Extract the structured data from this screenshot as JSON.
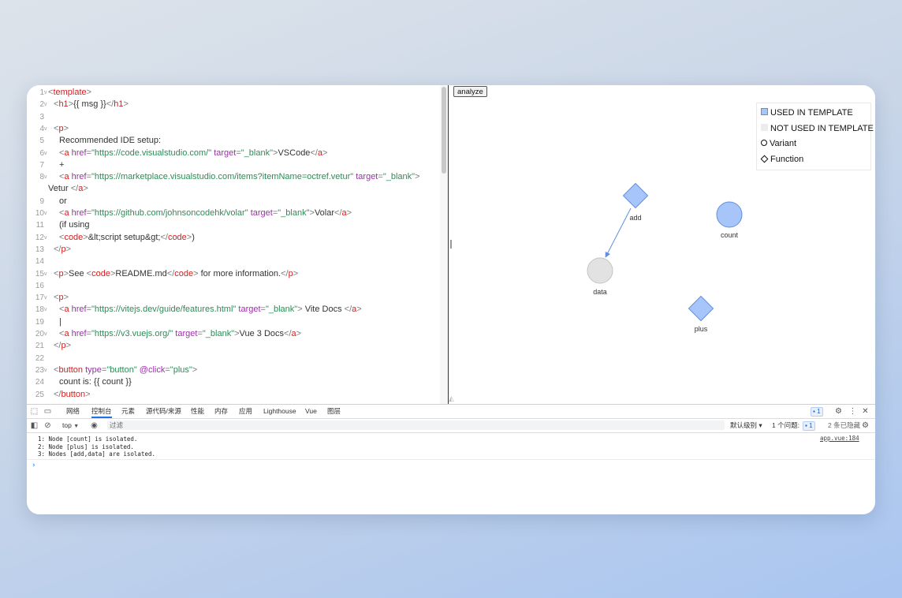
{
  "editor": {
    "lines": [
      {
        "n": "1",
        "fold": true,
        "indent": 0,
        "tokens": [
          [
            "punc",
            "<"
          ],
          [
            "tag",
            "template"
          ],
          [
            "punc",
            ">"
          ]
        ]
      },
      {
        "n": "2",
        "fold": true,
        "indent": 1,
        "tokens": [
          [
            "punc",
            "<"
          ],
          [
            "tag",
            "h1"
          ],
          [
            "punc",
            ">"
          ],
          [
            "txt",
            "{{ msg }}"
          ],
          [
            "punc",
            "</"
          ],
          [
            "tag",
            "h1"
          ],
          [
            "punc",
            ">"
          ]
        ]
      },
      {
        "n": "3",
        "fold": false,
        "indent": 0,
        "tokens": []
      },
      {
        "n": "4",
        "fold": true,
        "indent": 1,
        "tokens": [
          [
            "punc",
            "<"
          ],
          [
            "tag",
            "p"
          ],
          [
            "punc",
            ">"
          ]
        ]
      },
      {
        "n": "5",
        "fold": false,
        "indent": 2,
        "tokens": [
          [
            "txt",
            "Recommended IDE setup:"
          ]
        ]
      },
      {
        "n": "6",
        "fold": true,
        "indent": 2,
        "tokens": [
          [
            "punc",
            "<"
          ],
          [
            "tag",
            "a"
          ],
          [
            "txt",
            " "
          ],
          [
            "attr",
            "href"
          ],
          [
            "punc",
            "="
          ],
          [
            "str",
            "\"https://code.visualstudio.com/\""
          ],
          [
            "txt",
            " "
          ],
          [
            "attr",
            "target"
          ],
          [
            "punc",
            "="
          ],
          [
            "str",
            "\"_blank\""
          ],
          [
            "punc",
            ">"
          ],
          [
            "txt",
            "VSCode"
          ],
          [
            "punc",
            "</"
          ],
          [
            "tag",
            "a"
          ],
          [
            "punc",
            ">"
          ]
        ]
      },
      {
        "n": "7",
        "fold": false,
        "indent": 2,
        "tokens": [
          [
            "txt",
            "+"
          ]
        ]
      },
      {
        "n": "8",
        "fold": true,
        "indent": 2,
        "tokens": [
          [
            "punc",
            "<"
          ],
          [
            "tag",
            "a"
          ],
          [
            "txt",
            " "
          ],
          [
            "attr",
            "href"
          ],
          [
            "punc",
            "="
          ],
          [
            "str",
            "\"https://marketplace.visualstudio.com/items?itemName=octref.vetur\""
          ],
          [
            "txt",
            " "
          ],
          [
            "attr",
            "target"
          ],
          [
            "punc",
            "="
          ],
          [
            "str",
            "\"_blank\""
          ],
          [
            "punc",
            ">"
          ]
        ]
      },
      {
        "n": "",
        "fold": false,
        "indent": -1,
        "tokens": [
          [
            "txt",
            "Vetur "
          ],
          [
            "punc",
            "</"
          ],
          [
            "tag",
            "a"
          ],
          [
            "punc",
            ">"
          ]
        ]
      },
      {
        "n": "9",
        "fold": false,
        "indent": 2,
        "tokens": [
          [
            "txt",
            "or"
          ]
        ]
      },
      {
        "n": "10",
        "fold": true,
        "indent": 2,
        "tokens": [
          [
            "punc",
            "<"
          ],
          [
            "tag",
            "a"
          ],
          [
            "txt",
            " "
          ],
          [
            "attr",
            "href"
          ],
          [
            "punc",
            "="
          ],
          [
            "str",
            "\"https://github.com/johnsoncodehk/volar\""
          ],
          [
            "txt",
            " "
          ],
          [
            "attr",
            "target"
          ],
          [
            "punc",
            "="
          ],
          [
            "str",
            "\"_blank\""
          ],
          [
            "punc",
            ">"
          ],
          [
            "txt",
            "Volar"
          ],
          [
            "punc",
            "</"
          ],
          [
            "tag",
            "a"
          ],
          [
            "punc",
            ">"
          ]
        ]
      },
      {
        "n": "11",
        "fold": false,
        "indent": 2,
        "tokens": [
          [
            "txt",
            "(if using"
          ]
        ]
      },
      {
        "n": "12",
        "fold": true,
        "indent": 2,
        "tokens": [
          [
            "punc",
            "<"
          ],
          [
            "tag",
            "code"
          ],
          [
            "punc",
            ">"
          ],
          [
            "txt",
            "&lt;script setup&gt;"
          ],
          [
            "punc",
            "</"
          ],
          [
            "tag",
            "code"
          ],
          [
            "punc",
            ">"
          ],
          [
            "txt",
            ")"
          ]
        ]
      },
      {
        "n": "13",
        "fold": false,
        "indent": 1,
        "tokens": [
          [
            "punc",
            "</"
          ],
          [
            "tag",
            "p"
          ],
          [
            "punc",
            ">"
          ]
        ]
      },
      {
        "n": "14",
        "fold": false,
        "indent": 0,
        "tokens": []
      },
      {
        "n": "15",
        "fold": true,
        "indent": 1,
        "tokens": [
          [
            "punc",
            "<"
          ],
          [
            "tag",
            "p"
          ],
          [
            "punc",
            ">"
          ],
          [
            "txt",
            "See "
          ],
          [
            "punc",
            "<"
          ],
          [
            "tag",
            "code"
          ],
          [
            "punc",
            ">"
          ],
          [
            "txt",
            "README.md"
          ],
          [
            "punc",
            "</"
          ],
          [
            "tag",
            "code"
          ],
          [
            "punc",
            ">"
          ],
          [
            "txt",
            " for more information."
          ],
          [
            "punc",
            "</"
          ],
          [
            "tag",
            "p"
          ],
          [
            "punc",
            ">"
          ]
        ]
      },
      {
        "n": "16",
        "fold": false,
        "indent": 0,
        "tokens": []
      },
      {
        "n": "17",
        "fold": true,
        "indent": 1,
        "tokens": [
          [
            "punc",
            "<"
          ],
          [
            "tag",
            "p"
          ],
          [
            "punc",
            ">"
          ]
        ]
      },
      {
        "n": "18",
        "fold": true,
        "indent": 2,
        "tokens": [
          [
            "punc",
            "<"
          ],
          [
            "tag",
            "a"
          ],
          [
            "txt",
            " "
          ],
          [
            "attr",
            "href"
          ],
          [
            "punc",
            "="
          ],
          [
            "str",
            "\"https://vitejs.dev/guide/features.html\""
          ],
          [
            "txt",
            " "
          ],
          [
            "attr",
            "target"
          ],
          [
            "punc",
            "="
          ],
          [
            "str",
            "\"_blank\""
          ],
          [
            "punc",
            ">"
          ],
          [
            "txt",
            " Vite Docs "
          ],
          [
            "punc",
            "</"
          ],
          [
            "tag",
            "a"
          ],
          [
            "punc",
            ">"
          ]
        ]
      },
      {
        "n": "19",
        "fold": false,
        "indent": 2,
        "tokens": [
          [
            "txt",
            "|"
          ]
        ]
      },
      {
        "n": "20",
        "fold": true,
        "indent": 2,
        "tokens": [
          [
            "punc",
            "<"
          ],
          [
            "tag",
            "a"
          ],
          [
            "txt",
            " "
          ],
          [
            "attr",
            "href"
          ],
          [
            "punc",
            "="
          ],
          [
            "str",
            "\"https://v3.vuejs.org/\""
          ],
          [
            "txt",
            " "
          ],
          [
            "attr",
            "target"
          ],
          [
            "punc",
            "="
          ],
          [
            "str",
            "\"_blank\""
          ],
          [
            "punc",
            ">"
          ],
          [
            "txt",
            "Vue 3 Docs"
          ],
          [
            "punc",
            "</"
          ],
          [
            "tag",
            "a"
          ],
          [
            "punc",
            ">"
          ]
        ]
      },
      {
        "n": "21",
        "fold": false,
        "indent": 1,
        "tokens": [
          [
            "punc",
            "</"
          ],
          [
            "tag",
            "p"
          ],
          [
            "punc",
            ">"
          ]
        ]
      },
      {
        "n": "22",
        "fold": false,
        "indent": 0,
        "tokens": []
      },
      {
        "n": "23",
        "fold": true,
        "indent": 1,
        "tokens": [
          [
            "punc",
            "<"
          ],
          [
            "tag",
            "button"
          ],
          [
            "txt",
            " "
          ],
          [
            "attr",
            "type"
          ],
          [
            "punc",
            "="
          ],
          [
            "str",
            "\"button\""
          ],
          [
            "txt",
            " "
          ],
          [
            "attr",
            "@click"
          ],
          [
            "punc",
            "="
          ],
          [
            "str",
            "\"plus\""
          ],
          [
            "punc",
            ">"
          ]
        ]
      },
      {
        "n": "24",
        "fold": false,
        "indent": 2,
        "tokens": [
          [
            "txt",
            "count is: {{ count }}"
          ]
        ]
      },
      {
        "n": "25",
        "fold": false,
        "indent": 1,
        "tokens": [
          [
            "punc",
            "</"
          ],
          [
            "tag",
            "button"
          ],
          [
            "punc",
            ">"
          ]
        ]
      }
    ]
  },
  "graph": {
    "analyze_label": "analyze",
    "legend": {
      "used": "USED IN TEMPLATE",
      "not_used": "NOT USED IN TEMPLATE",
      "variant": "Variant",
      "function": "Function"
    },
    "nodes": {
      "add": "add",
      "count": "count",
      "data": "data",
      "plus": "plus"
    },
    "colors": {
      "used_fill": "#a7c5f9",
      "used_stroke": "#5e8fe0",
      "not_used_fill": "#e2e2e2",
      "not_used_stroke": "#c4c4c4",
      "edge": "#5e8fe0"
    }
  },
  "devtools": {
    "tabs": [
      "网络",
      "控制台",
      "元素",
      "源代码/来源",
      "性能",
      "内存",
      "应用",
      "Lighthouse",
      "Vue",
      "图层"
    ],
    "active_tab": "控制台",
    "issues_badge": "1",
    "context": "top",
    "filter_placeholder": "过滤",
    "level": "默认级别 ▾",
    "issues_label": "1 个问题:",
    "issues_count": "1",
    "hidden": "2 条已隐藏",
    "messages": [
      "1: Node [count] is isolated.",
      "2: Node [plus] is isolated.",
      "3: Nodes [add,data] are isolated."
    ],
    "source": "app.vue:184",
    "prompt": "›"
  }
}
